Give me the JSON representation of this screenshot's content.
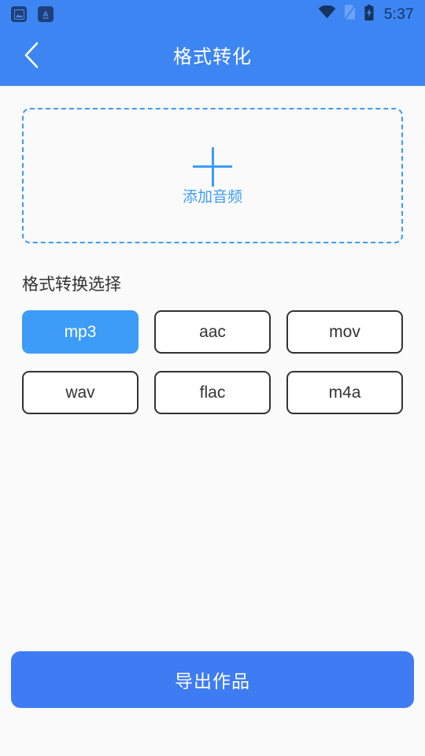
{
  "statusbar": {
    "time": "5:37",
    "left_icons": [
      {
        "name": "image-icon"
      },
      {
        "name": "translate-icon",
        "glyph": "A"
      }
    ],
    "right_icons": [
      {
        "name": "wifi-icon"
      },
      {
        "name": "sim-off-icon"
      },
      {
        "name": "battery-charging-icon"
      }
    ]
  },
  "appbar": {
    "back_icon": "chevron-left-icon",
    "title": "格式转化"
  },
  "dropzone": {
    "plus_icon": "plus-icon",
    "label": "添加音频"
  },
  "formats": {
    "section_title": "格式转换选择",
    "selected": "mp3",
    "options": [
      {
        "label": "mp3",
        "selected": true
      },
      {
        "label": "aac",
        "selected": false
      },
      {
        "label": "mov",
        "selected": false
      },
      {
        "label": "wav",
        "selected": false
      },
      {
        "label": "flac",
        "selected": false
      },
      {
        "label": "m4a",
        "selected": false
      }
    ]
  },
  "export": {
    "label": "导出作品"
  },
  "colors": {
    "header_blue": "#3d85f2",
    "accent_blue": "#3d9cf8",
    "button_blue": "#3d7cf2",
    "page_bg": "#fafafa",
    "border_dark": "#333333",
    "status_icon": "#1f3f7a"
  }
}
